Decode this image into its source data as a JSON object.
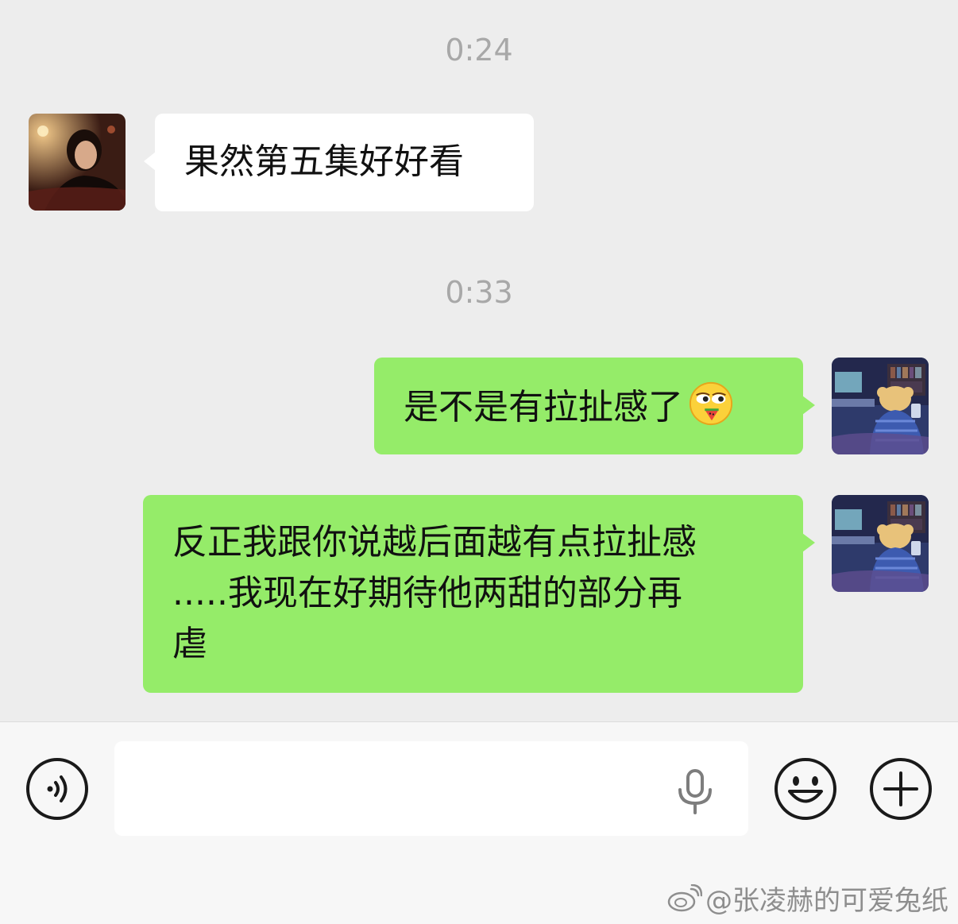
{
  "messages": [
    {
      "time": "0:24"
    },
    {
      "sender": "friend",
      "text": "果然第五集好好看"
    },
    {
      "time": "0:33"
    },
    {
      "sender": "me",
      "text": "是不是有拉扯感了",
      "emoji": "watermelon-smirk-emoji"
    },
    {
      "sender": "me",
      "lines": [
        "反正我跟你说越后面越有点拉扯感",
        ".....我现在好期待他两甜的部分再",
        "虐"
      ]
    }
  ],
  "input": {
    "value": "",
    "icons": [
      "voice-icon",
      "microphone-icon",
      "emoji-icon",
      "plus-icon"
    ]
  },
  "watermark": {
    "text": "@张凌赫的可爱兔纸",
    "icon": "weibo-icon"
  },
  "colors": {
    "background": "#ededed",
    "my_bubble": "#95ec69",
    "friend_bubble": "#ffffff",
    "timestamp": "#a8a8a8"
  }
}
